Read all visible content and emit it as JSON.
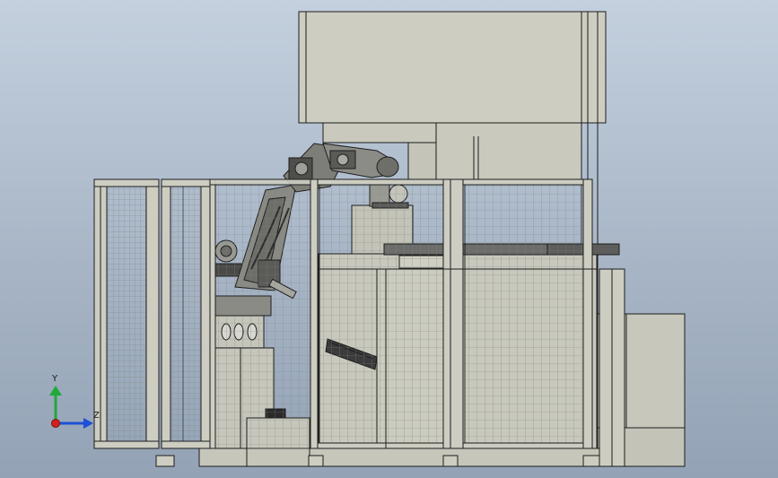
{
  "viewport": {
    "background_top": "#c4d0de",
    "background_bottom": "#93a2b5"
  },
  "colors": {
    "frame": "#cfcfc4",
    "frame_dark": "#b9b9ad",
    "line": "#1d1d1d",
    "mesh": "#8f9a91",
    "robot": "#7c7c78",
    "robot_dark": "#3a3a3a"
  },
  "triad": {
    "y_label": "Y",
    "z_label": "Z",
    "y_color": "#1faa3a",
    "z_color": "#1f4fd6",
    "x_color": "#d41f1f"
  }
}
